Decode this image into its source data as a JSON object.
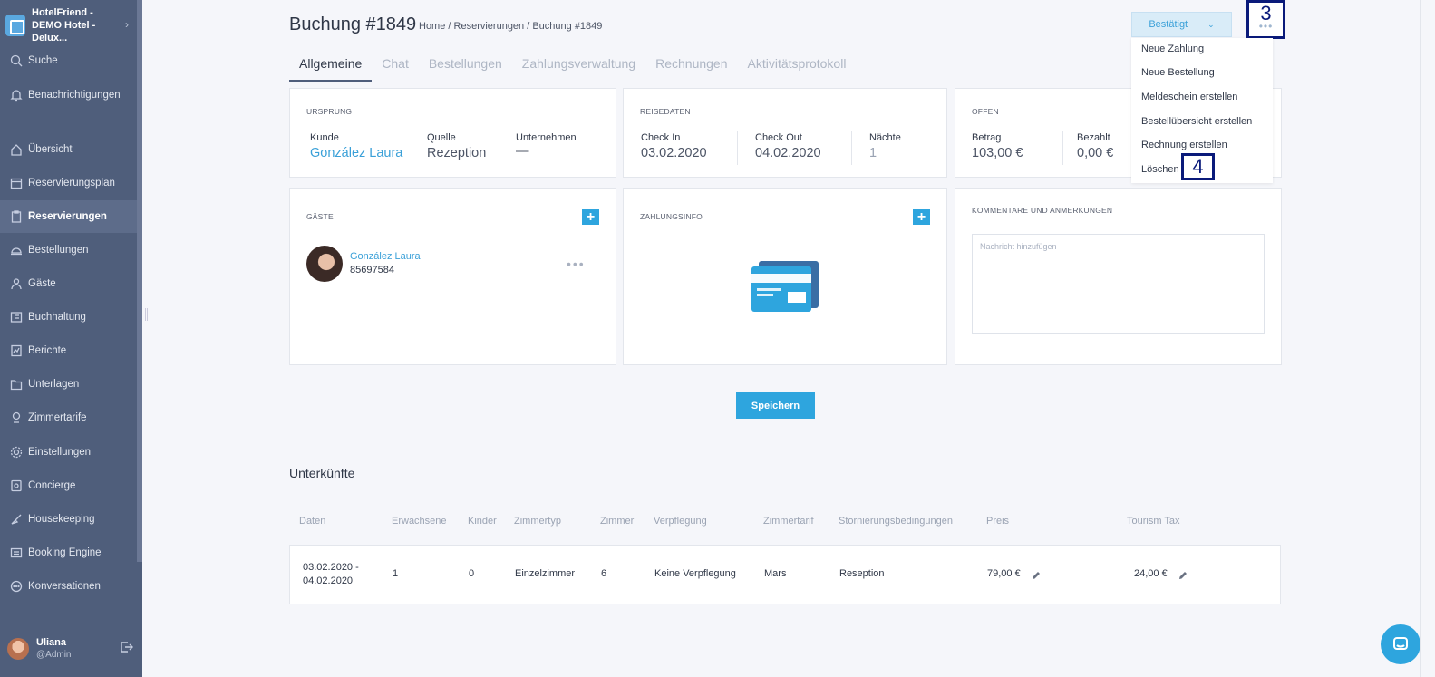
{
  "sidebar": {
    "brand": "HotelFriend - DEMO Hotel - Delux...",
    "items": [
      {
        "label": "Suche",
        "icon": "search-icon"
      },
      {
        "label": "Benachrichtigungen",
        "icon": "bell-icon"
      },
      {
        "label": "Übersicht",
        "icon": "home-icon"
      },
      {
        "label": "Reservierungsplan",
        "icon": "calendar-icon"
      },
      {
        "label": "Reservierungen",
        "icon": "clipboard-icon"
      },
      {
        "label": "Bestellungen",
        "icon": "cloche-icon"
      },
      {
        "label": "Gäste",
        "icon": "person-icon"
      },
      {
        "label": "Buchhaltung",
        "icon": "ledger-icon"
      },
      {
        "label": "Berichte",
        "icon": "report-icon"
      },
      {
        "label": "Unterlagen",
        "icon": "folder-icon"
      },
      {
        "label": "Zimmertarife",
        "icon": "tag-icon"
      },
      {
        "label": "Einstellungen",
        "icon": "gear-icon"
      },
      {
        "label": "Concierge",
        "icon": "concierge-icon"
      },
      {
        "label": "Housekeeping",
        "icon": "broom-icon"
      },
      {
        "label": "Booking Engine",
        "icon": "booking-icon"
      },
      {
        "label": "Konversationen",
        "icon": "chat-icon"
      }
    ],
    "user": {
      "name": "Uliana",
      "role": "@Admin"
    }
  },
  "header": {
    "title": "Buchung #1849",
    "breadcrumb": "Home / Reservierungen / Buchung #1849",
    "status": "Bestätigt",
    "marker3": "3"
  },
  "tabs": [
    "Allgemeine",
    "Chat",
    "Bestellungen",
    "Zahlungsverwaltung",
    "Rechnungen",
    "Aktivitätsprotokoll"
  ],
  "origin": {
    "title": "URSPRUNG",
    "kunde_label": "Kunde",
    "kunde_value": "González Laura",
    "quelle_label": "Quelle",
    "quelle_value": "Rezeption",
    "unternehmen_label": "Unternehmen",
    "unternehmen_value": "—"
  },
  "travel": {
    "title": "REISEDATEN",
    "checkin_label": "Check In",
    "checkin_value": "03.02.2020",
    "checkout_label": "Check Out",
    "checkout_value": "04.02.2020",
    "nights_label": "Nächte",
    "nights_value": "1"
  },
  "open": {
    "title": "OFFEN",
    "betrag_label": "Betrag",
    "betrag_value": "103,00 €",
    "bezahlt_label": "Bezahlt",
    "bezahlt_value": "0,00 €"
  },
  "guests": {
    "title": "GÄSTE",
    "plus": "+",
    "name": "González Laura",
    "id": "85697584"
  },
  "payment": {
    "title": "ZAHLUNGSINFO",
    "plus": "+"
  },
  "comments": {
    "title": "KOMMENTARE UND ANMERKUNGEN",
    "placeholder": "Nachricht hinzufügen"
  },
  "save_label": "Speichern",
  "dropdown": {
    "items": [
      "Neue Zahlung",
      "Neue Bestellung",
      "Meldeschein erstellen",
      "Bestellübersicht erstellen",
      "Rechnung erstellen",
      "Löschen"
    ],
    "marker4": "4"
  },
  "accommodations": {
    "title": "Unterkünfte",
    "headers": [
      "Daten",
      "Erwachsene",
      "Kinder",
      "Zimmertyp",
      "Zimmer",
      "Verpflegung",
      "Zimmertarif",
      "Stornierungsbedingungen",
      "Preis",
      "Tourism Tax"
    ],
    "row": {
      "date_from": "03.02.2020 -",
      "date_to": "04.02.2020",
      "adults": "1",
      "children": "0",
      "room_type": "Einzelzimmer",
      "room": "6",
      "board": "Keine Verpflegung",
      "rate": "Mars",
      "cancellation": "Reseption",
      "price": "79,00 €",
      "tax": "24,00 €"
    }
  },
  "colors": {
    "accent": "#2ea5de",
    "sidebar": "#4f5e7b",
    "marker": "#0a1a7a"
  }
}
